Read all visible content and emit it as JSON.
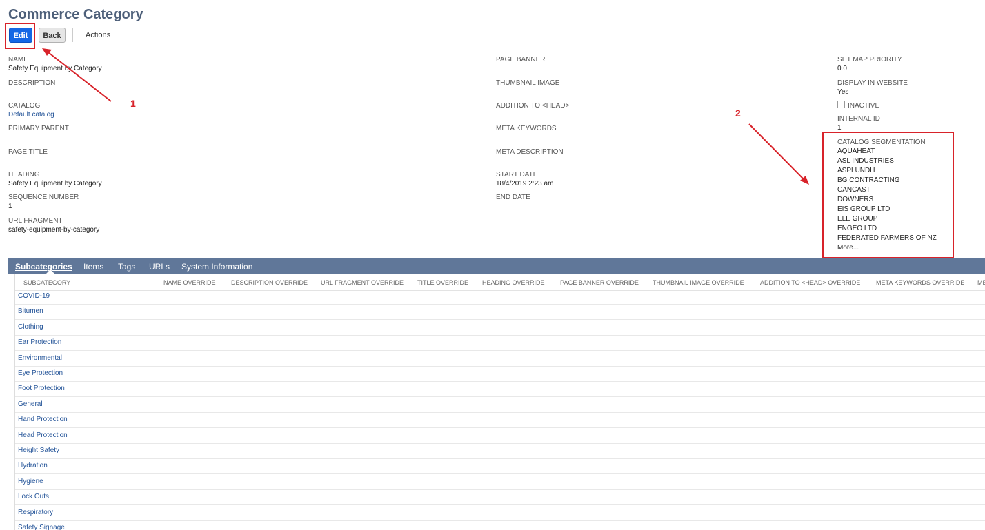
{
  "page": {
    "title": "Commerce Category"
  },
  "toolbar": {
    "edit_label": "Edit",
    "back_label": "Back",
    "actions_label": "Actions"
  },
  "annotations": {
    "label_1": "1",
    "label_2": "2",
    "color": "#d8232a"
  },
  "left_col": {
    "name": {
      "label": "NAME",
      "value": "Safety Equipment by Category"
    },
    "description": {
      "label": "DESCRIPTION",
      "value": ""
    },
    "catalog": {
      "label": "CATALOG",
      "value": "Default catalog"
    },
    "primary_parent": {
      "label": "PRIMARY PARENT",
      "value": ""
    },
    "page_title": {
      "label": "PAGE TITLE",
      "value": ""
    },
    "heading": {
      "label": "HEADING",
      "value": "Safety Equipment by Category"
    },
    "sequence_number": {
      "label": "SEQUENCE NUMBER",
      "value": "1"
    },
    "url_fragment": {
      "label": "URL FRAGMENT",
      "value": "safety-equipment-by-category"
    }
  },
  "mid_col": {
    "page_banner": {
      "label": "PAGE BANNER"
    },
    "thumbnail_image": {
      "label": "THUMBNAIL IMAGE"
    },
    "addition_to_head": {
      "label": "ADDITION TO <HEAD>"
    },
    "meta_keywords": {
      "label": "META KEYWORDS"
    },
    "meta_description": {
      "label": "META DESCRIPTION"
    },
    "start_date": {
      "label": "START DATE",
      "value": "18/4/2019 2:23 am"
    },
    "end_date": {
      "label": "END DATE"
    }
  },
  "right_col": {
    "sitemap_priority": {
      "label": "SITEMAP PRIORITY",
      "value": "0.0"
    },
    "display_in_website": {
      "label": "DISPLAY IN WEBSITE",
      "value": "Yes"
    },
    "inactive": {
      "label": "INACTIVE",
      "checked": false
    },
    "internal_id": {
      "label": "INTERNAL ID",
      "value": "1"
    },
    "catalog_segmentation": {
      "label": "CATALOG SEGMENTATION",
      "items": [
        "AQUAHEAT",
        "ASL INDUSTRIES",
        "ASPLUNDH",
        "BG CONTRACTING",
        "CANCAST",
        "DOWNERS",
        "EIS GROUP LTD",
        "ELE GROUP",
        "ENGEO LTD",
        "FEDERATED FARMERS OF NZ"
      ],
      "more": "More..."
    }
  },
  "tabs": [
    "Subcategories",
    "Items",
    "Tags",
    "URLs",
    "System Information"
  ],
  "grid": {
    "columns": [
      "SUBCATEGORY",
      "NAME OVERRIDE",
      "DESCRIPTION OVERRIDE",
      "URL FRAGMENT OVERRIDE",
      "TITLE OVERRIDE",
      "HEADING OVERRIDE",
      "PAGE BANNER OVERRIDE",
      "THUMBNAIL IMAGE OVERRIDE",
      "ADDITION TO <HEAD> OVERRIDE",
      "META KEYWORDS OVERRIDE",
      "ME"
    ],
    "rows": [
      "COVID-19",
      "Bitumen",
      "Clothing",
      "Ear Protection",
      "Environmental",
      "Eye Protection",
      "Foot Protection",
      "General",
      "Hand Protection",
      "Head Protection",
      "Height Safety",
      "Hydration",
      "Hygiene",
      "Lock Outs",
      "Respiratory",
      "Safety Signage"
    ]
  }
}
